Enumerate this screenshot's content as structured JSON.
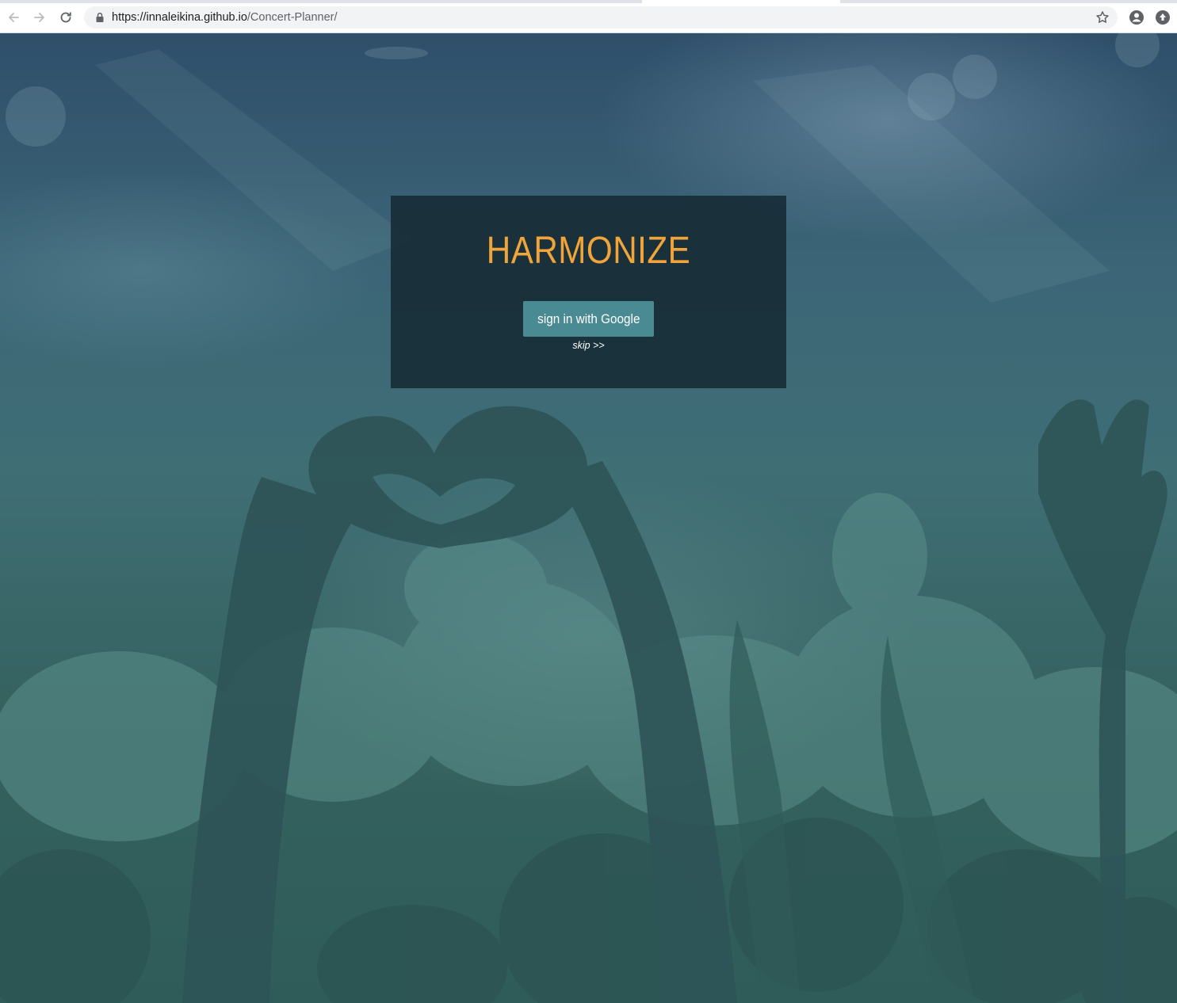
{
  "browser": {
    "url_host": "https://innaleikina.github.io",
    "url_path": "/Concert-Planner/",
    "icons": [
      "back-icon",
      "forward-icon",
      "reload-icon",
      "lock-icon",
      "star-icon",
      "profile-icon",
      "extension-icon"
    ]
  },
  "login": {
    "brand": "HARMONIZE",
    "google_button": "sign in with Google",
    "skip_link": "skip >>"
  },
  "colors": {
    "brand": "#f0a43a",
    "button": "#4a8a92",
    "card": "#162a34",
    "background": "#2f5c59"
  }
}
